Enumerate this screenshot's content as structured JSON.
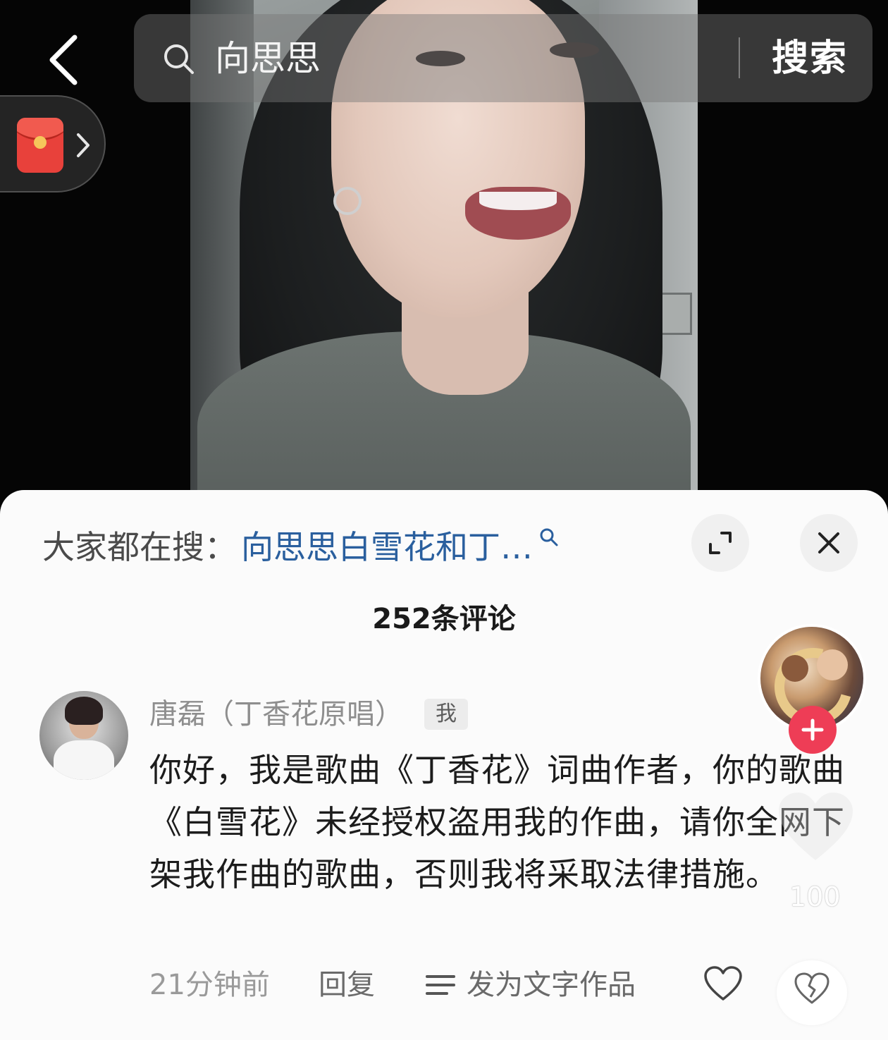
{
  "search": {
    "query": "向思思",
    "button_label": "搜索"
  },
  "trending": {
    "label": "大家都在搜：",
    "query": "向思思白雪花和丁…"
  },
  "comments": {
    "count_label": "252条评论",
    "items": [
      {
        "author": "唐磊（丁香花原唱）",
        "badge": "我",
        "text": "你好，我是歌曲《丁香花》词曲作者，你的歌曲《白雪花》未经授权盗用我的作曲，请你全网下架我作曲的歌曲，否则我将采取法律措施。",
        "time": "21分钟前",
        "reply_label": "回复",
        "ai_label": "发为文字作品"
      }
    ]
  },
  "floating_like": {
    "count": "100"
  },
  "icons": {
    "back": "back-arrow-icon",
    "search": "search-icon",
    "red_packet": "red-envelope-icon",
    "expand": "expand-icon",
    "close": "close-icon",
    "follow": "plus-icon",
    "like": "heart-icon",
    "dislike": "broken-heart-icon"
  },
  "colors": {
    "trending_link": "#2a5f9e",
    "follow_button": "#ee3d56",
    "red_packet": "#e8413b"
  }
}
